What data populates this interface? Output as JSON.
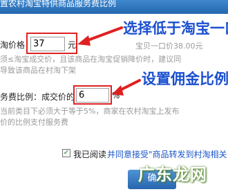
{
  "header": {
    "title": "置农村淘宝特供商品服务费比例"
  },
  "price": {
    "label": "淘价格：",
    "value": "37",
    "unit": "元",
    "reference": "宝贝一口价38.00元",
    "hint_line1": "须≤淘宝成交价，且该商品在淘宝促销降价时，建议同",
    "hint_line2": "导致该商品在村淘下架"
  },
  "fee": {
    "label": "务费比例：成交价的",
    "value": "6",
    "unit": "%",
    "hint_line1": "当前类目下必须大于等于5%，商家在农村淘宝上发布",
    "hint_line2": "价的比例支付服务费"
  },
  "annotations": {
    "price_note": "选择低于淘宝一口",
    "fee_note": "设置佣金比例"
  },
  "agreement": {
    "prefix": "我已阅读",
    "link": "并同意接受\"商品转发到村淘相关",
    "checked_mark": "✓"
  },
  "submit": {
    "label": "确"
  },
  "watermark": {
    "text": "广东龙网"
  },
  "colors": {
    "header": "#2a6fb8",
    "annotation": "#1a4fd0",
    "arrow": "#e02020",
    "link": "#1a56c8"
  }
}
